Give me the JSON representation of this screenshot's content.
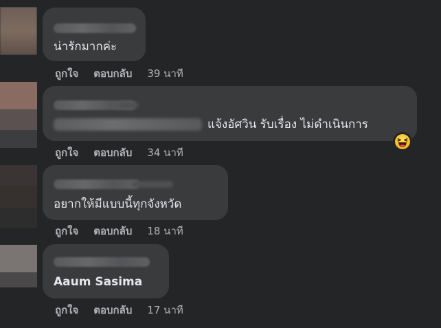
{
  "comments": [
    {
      "text": "น่ารักมากค่ะ",
      "actions": {
        "like": "ถูกใจ",
        "reply": "ตอบกลับ",
        "time": "39 นาที"
      }
    },
    {
      "text": "แจ้งอัศวิน รับเรื่อง ไม่ดำเนินการ",
      "reaction_icon": "laughing-emoji-icon",
      "actions": {
        "like": "ถูกใจ",
        "reply": "ตอบกลับ",
        "time": "34 นาที"
      }
    },
    {
      "text": "อยากให้มีแบบนี้ทุกจังหวัด",
      "actions": {
        "like": "ถูกใจ",
        "reply": "ตอบกลับ",
        "time": "18 นาที"
      }
    },
    {
      "text": "Aaum Sasima",
      "actions": {
        "like": "ถูกใจ",
        "reply": "ตอบกลับ",
        "time": "17 นาที"
      }
    }
  ],
  "colors": {
    "background": "#242526",
    "bubble": "#3a3b3c",
    "text_primary": "#e4e6eb",
    "text_secondary": "#b0b3b8"
  }
}
